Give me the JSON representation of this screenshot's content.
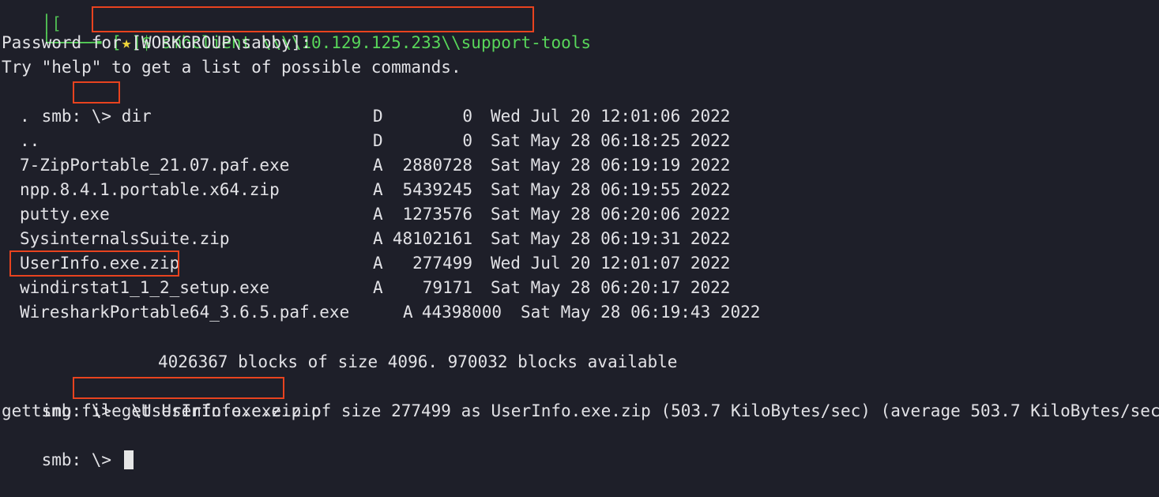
{
  "terminal": {
    "prompt_tail": "[★]$",
    "box_corner": "└────╼",
    "command_connect": "smbclient \\\\\\\\10.129.125.233\\\\support-tools",
    "password_prompt": "Password for [WORKGROUP\\sabby]:",
    "help_hint": "Try \"help\" to get a list of possible commands.",
    "smb_prompt": "smb: \\>",
    "command_dir": "dir",
    "files": [
      {
        "name": ".",
        "attr": "D",
        "size": "0",
        "date": "Wed Jul 20 12:01:06 2022"
      },
      {
        "name": "..",
        "attr": "D",
        "size": "0",
        "date": "Sat May 28 06:18:25 2022"
      },
      {
        "name": "7-ZipPortable_21.07.paf.exe",
        "attr": "A",
        "size": "2880728",
        "date": "Sat May 28 06:19:19 2022"
      },
      {
        "name": "npp.8.4.1.portable.x64.zip",
        "attr": "A",
        "size": "5439245",
        "date": "Sat May 28 06:19:55 2022"
      },
      {
        "name": "putty.exe",
        "attr": "A",
        "size": "1273576",
        "date": "Sat May 28 06:20:06 2022"
      },
      {
        "name": "SysinternalsSuite.zip",
        "attr": "A",
        "size": "48102161",
        "date": "Sat May 28 06:19:31 2022"
      },
      {
        "name": "UserInfo.exe.zip",
        "attr": "A",
        "size": "277499",
        "date": "Wed Jul 20 12:01:07 2022"
      },
      {
        "name": "windirstat1_1_2_setup.exe",
        "attr": "A",
        "size": "79171",
        "date": "Sat May 28 06:20:17 2022"
      },
      {
        "name": "WiresharkPortable64_3.6.5.paf.exe",
        "attr": "A",
        "size": "44398000",
        "date": "Sat May 28 06:19:43 2022"
      }
    ],
    "blocks_summary": "4026367 blocks of size 4096. 970032 blocks available",
    "command_get": "get UserInfo.exe.zip",
    "get_output": "getting file \\UserInfo.exe.zip of size 277499 as UserInfo.exe.zip (503.7 KiloBytes/sec) (average 503.7 KiloBytes/sec)"
  },
  "colors": {
    "background": "#1e1f29",
    "text": "#e2e2e6",
    "highlight_box": "#e8431f",
    "prompt_green": "#58d65a",
    "prompt_star": "#f1d63a"
  }
}
